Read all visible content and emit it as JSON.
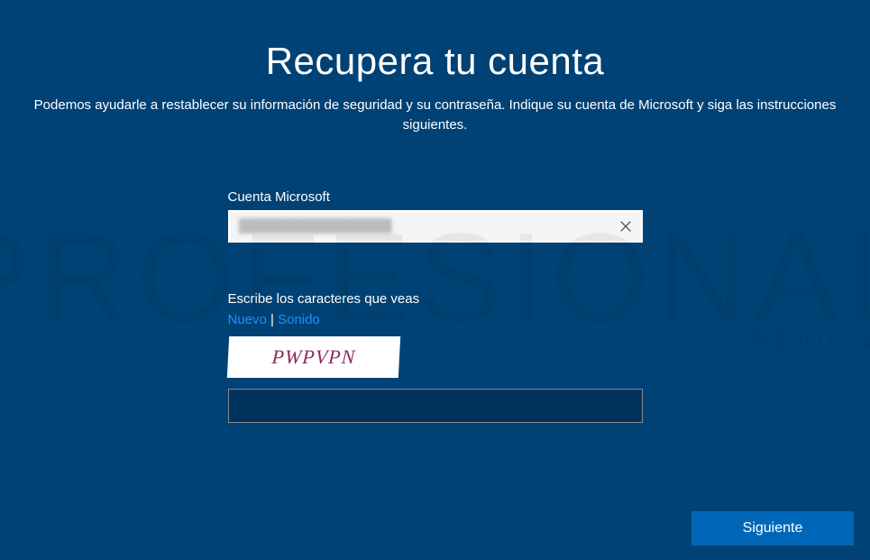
{
  "title": "Recupera tu cuenta",
  "subtitle": "Podemos ayudarle a restablecer su información de seguridad y su contraseña. Indique su cuenta de Microsoft y siga las instrucciones siguientes.",
  "account": {
    "label": "Cuenta Microsoft",
    "value": "████████████████"
  },
  "captcha": {
    "label": "Escribe los caracteres que veas",
    "new_link": "Nuevo",
    "audio_link": "Sonido",
    "separator": " | ",
    "image_text": "PWPVPN",
    "input_value": ""
  },
  "buttons": {
    "next": "Siguiente"
  },
  "watermark": {
    "main": "PROFESIONAL",
    "sub": "REVIEW"
  }
}
